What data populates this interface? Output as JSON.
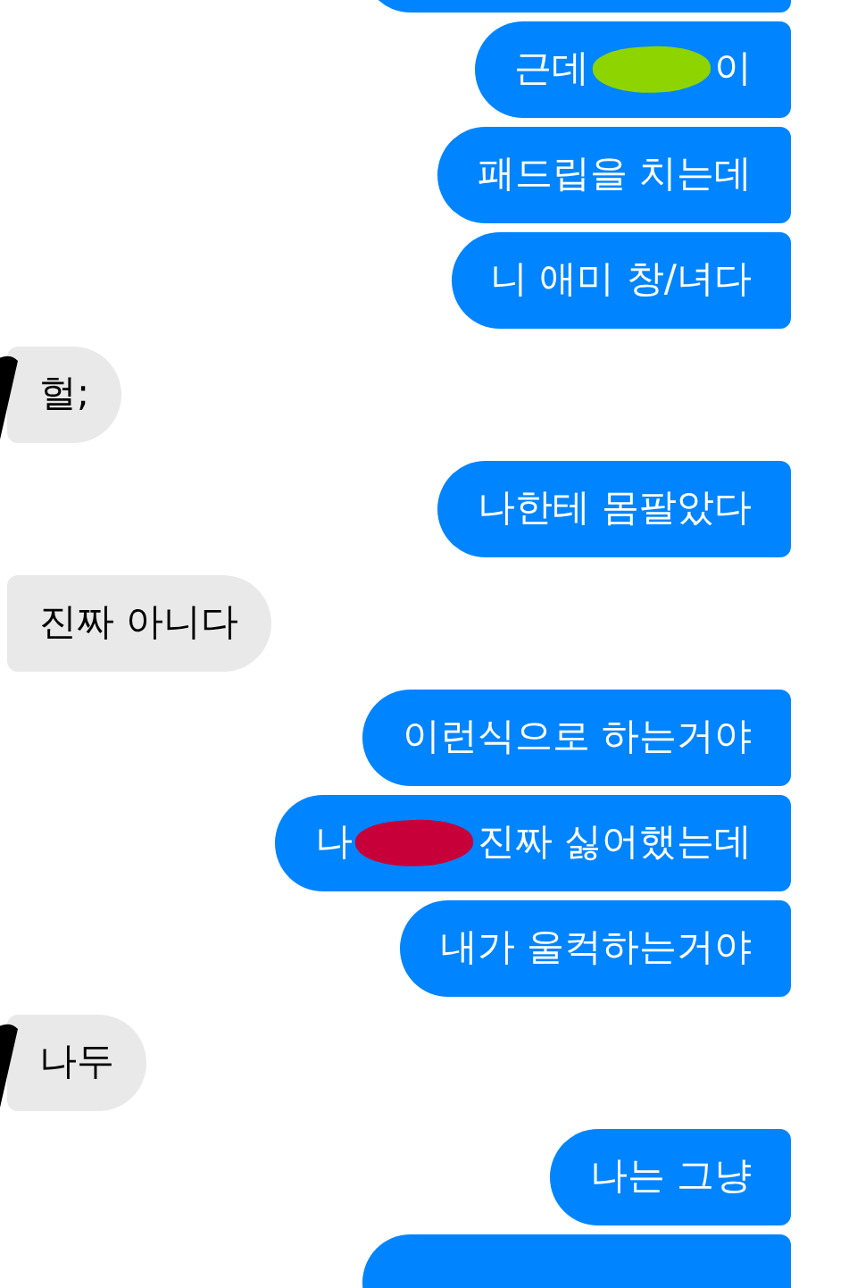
{
  "messages": [
    {
      "kind": "sent",
      "partial": true
    },
    {
      "kind": "sent",
      "parts": [
        {
          "kind": "text",
          "text": "근데"
        },
        {
          "kind": "redaction",
          "color": "#8ed400"
        },
        {
          "kind": "text",
          "text": "이"
        }
      ]
    },
    {
      "kind": "sent",
      "parts": [
        {
          "kind": "text",
          "text": "패드립을 치는데"
        }
      ]
    },
    {
      "kind": "sent",
      "parts": [
        {
          "kind": "text",
          "text": "니 애미 창/녀다"
        }
      ]
    },
    {
      "kind": "received",
      "avatar": true,
      "parts": [
        {
          "kind": "text",
          "text": "헐;"
        }
      ]
    },
    {
      "kind": "sent",
      "parts": [
        {
          "kind": "text",
          "text": "나한테 몸팔았다"
        }
      ]
    },
    {
      "kind": "received",
      "avatar": false,
      "parts": [
        {
          "kind": "text",
          "text": "진짜 아니다"
        }
      ]
    },
    {
      "kind": "sent",
      "parts": [
        {
          "kind": "text",
          "text": "이런식으로 하는거야"
        }
      ]
    },
    {
      "kind": "sent",
      "parts": [
        {
          "kind": "text",
          "text": "나"
        },
        {
          "kind": "redaction",
          "color": "#c8003a"
        },
        {
          "kind": "text",
          "text": "진짜 싫어했는데"
        }
      ]
    },
    {
      "kind": "sent",
      "parts": [
        {
          "kind": "text",
          "text": "내가 울컥하는거야"
        }
      ]
    },
    {
      "kind": "received",
      "avatar": true,
      "parts": [
        {
          "kind": "text",
          "text": "나두"
        }
      ]
    },
    {
      "kind": "sent",
      "parts": [
        {
          "kind": "text",
          "text": "나는 그냥"
        }
      ]
    },
    {
      "kind": "sent",
      "partial": true
    }
  ]
}
